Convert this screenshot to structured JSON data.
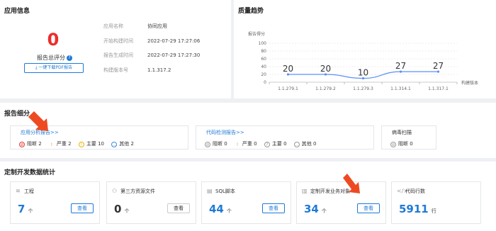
{
  "app_info": {
    "title": "应用信息",
    "score": "0",
    "score_label": "报告总评分",
    "help_icon": "?",
    "pdf_button": "⤓ 一键下载PDF报告",
    "rows": [
      {
        "key": "应用名称",
        "value": "协同应用"
      },
      {
        "key": "开始构建时间",
        "value": "2022-07-29 17:27:06"
      },
      {
        "key": "报告生成时间",
        "value": "2022-07-29 17:27:30"
      },
      {
        "key": "构建版本号",
        "value": "1.1.317.2"
      }
    ]
  },
  "trend": {
    "title": "质量趋势"
  },
  "chart_data": {
    "type": "line",
    "title": "",
    "ylabel": "报告得分",
    "xlabel": "构建版本",
    "categories": [
      "1.1.279.1",
      "1.1.279.2",
      "1.1.279.3",
      "1.1.314.1",
      "1.1.317.1"
    ],
    "series": [
      {
        "values": [
          20,
          20,
          10,
          27,
          27
        ]
      }
    ],
    "yticks": [
      "0",
      "20",
      "40",
      "60",
      "80",
      "100"
    ],
    "ylim": [
      0,
      100
    ],
    "grid": true,
    "line_color": "#5b8ff9"
  },
  "report_detail": {
    "title": "报告细分",
    "boxes": [
      {
        "title": "应用分析报告>>",
        "link": true,
        "stats": [
          {
            "icon": "⊘",
            "label": "阻断 2",
            "color": "#e23a3a"
          },
          {
            "icon": "!",
            "label": "严重 2",
            "color": "#f07b2a"
          },
          {
            "icon": "!",
            "label": "主要 10",
            "color": "#e8b400"
          },
          {
            "icon": "…",
            "label": "其他 2",
            "color": "#3a8ee6"
          }
        ]
      },
      {
        "title": "代码检测报告>>",
        "link": true,
        "stats": [
          {
            "icon": "⊘",
            "label": "阻断 0",
            "color": "#999999"
          },
          {
            "icon": "!",
            "label": "严重 0",
            "color": "#999999"
          },
          {
            "icon": "?",
            "label": "主要 0",
            "color": "#999999"
          },
          {
            "icon": "…",
            "label": "其他 0",
            "color": "#999999"
          }
        ]
      },
      {
        "title": "病毒扫描",
        "link": false,
        "stats": [
          {
            "icon": "⊘",
            "label": "阻断 0",
            "color": "#999999"
          }
        ]
      }
    ]
  },
  "dev_stats": {
    "title": "定制开发数据统计",
    "cards": [
      {
        "icon": "≋",
        "label": "工程",
        "value": "7",
        "unit": "个",
        "button": "查看"
      },
      {
        "icon": "⚇",
        "label": "第三方资源文件",
        "value": "0",
        "unit": "个",
        "button": "查看"
      },
      {
        "icon": "▤",
        "label": "SQL脚本",
        "value": "44",
        "unit": "个",
        "button": "查看"
      },
      {
        "icon": "▥",
        "label": "定制开发业务对象",
        "value": "34",
        "unit": "个",
        "button": "查看"
      },
      {
        "icon": "</>",
        "label": "代码行数",
        "value": "5911",
        "unit": "行",
        "button": ""
      }
    ]
  }
}
